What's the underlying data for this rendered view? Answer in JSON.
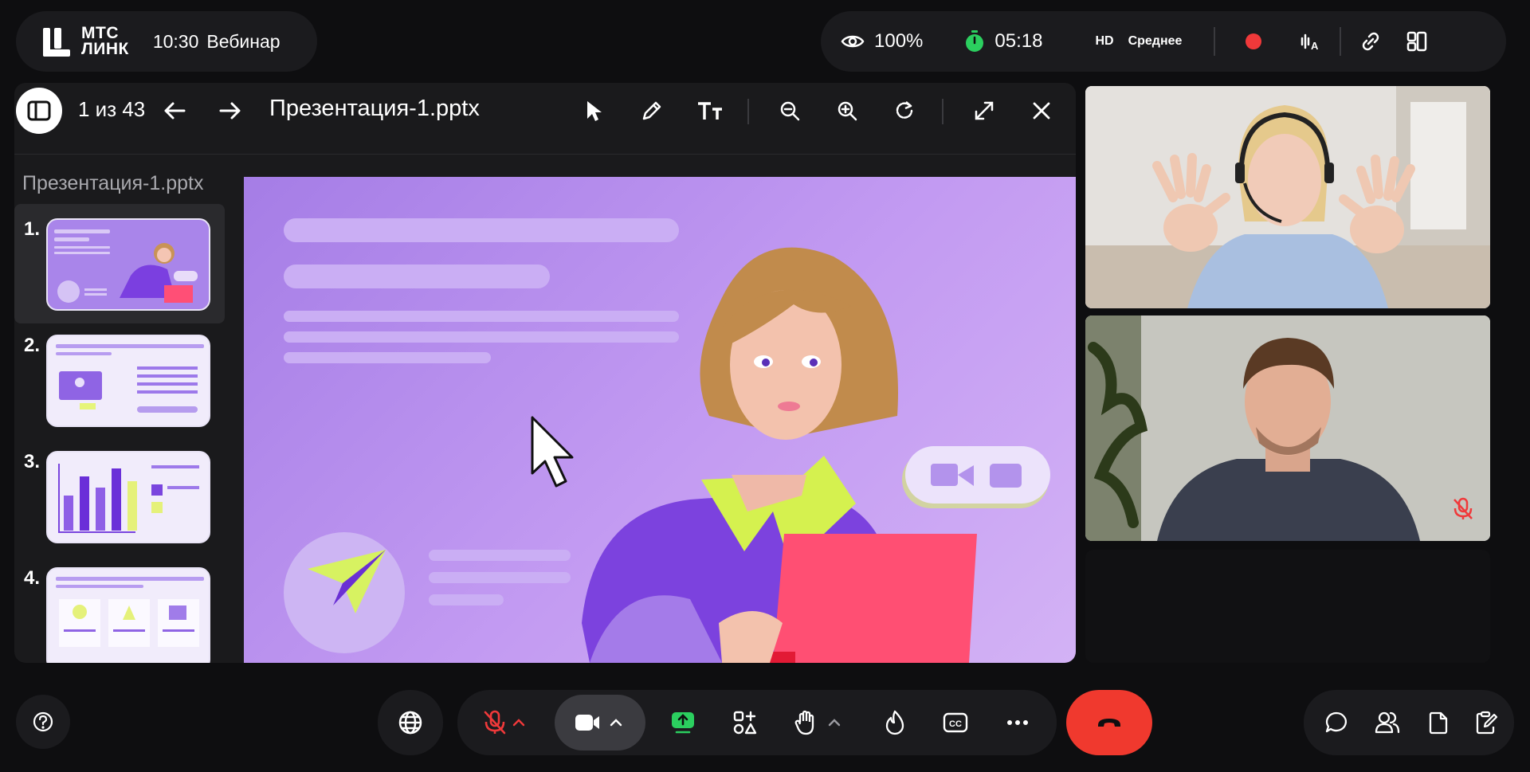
{
  "header": {
    "brand_line1": "МТС",
    "brand_line2": "ЛИНК",
    "time": "10:30",
    "event_title": "Вебинар"
  },
  "status": {
    "visibility": "100%",
    "timer": "05:18",
    "quality": "HD",
    "quality_level": "Среднее",
    "recording": true,
    "icons": [
      "eye-icon",
      "stopwatch-icon",
      "audio-language-icon",
      "link-icon",
      "layout-icon"
    ]
  },
  "presentation": {
    "page_indicator": "1 из 43",
    "file_name": "Презентация-1.pptx",
    "sidebar_title": "Презентация-1.pptx",
    "thumbnails": [
      {
        "num": "1.",
        "active": true
      },
      {
        "num": "2.",
        "active": false
      },
      {
        "num": "3.",
        "active": false
      },
      {
        "num": "4.",
        "active": false
      }
    ],
    "tools": [
      "pointer-icon",
      "pencil-icon",
      "text-tool-icon",
      "zoom-out-icon",
      "zoom-in-icon",
      "rotate-icon",
      "fullscreen-icon",
      "close-icon"
    ]
  },
  "participants": [
    {
      "role": "speaker-woman",
      "muted": false
    },
    {
      "role": "speaker-man",
      "muted": true
    }
  ],
  "controls": {
    "icons": [
      "help-icon",
      "globe-icon",
      "mic-off-icon",
      "camera-icon",
      "share-screen-icon",
      "apps-icon",
      "raise-hand-icon",
      "reaction-icon",
      "captions-icon",
      "more-icon",
      "hangup-icon",
      "chat-icon",
      "participants-icon",
      "files-icon",
      "notes-icon"
    ],
    "captions_label": "CC"
  },
  "colors": {
    "accent_red": "#f0393a",
    "accent_green": "#2bcf5f",
    "slide_purple": "#a985ea"
  }
}
